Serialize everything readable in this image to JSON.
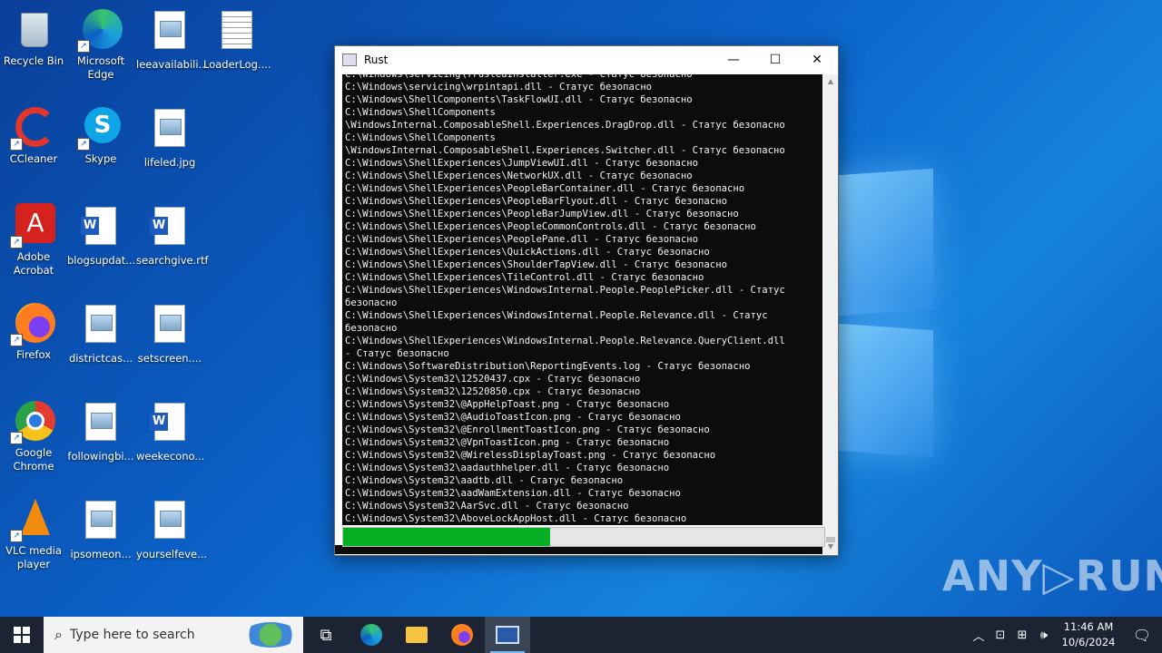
{
  "desktop": {
    "icons": [
      {
        "label": "Recycle Bin"
      },
      {
        "label": "Microsoft\nEdge"
      },
      {
        "label": "leeavailabili..."
      },
      {
        "label": "LoaderLog...."
      },
      {
        "label": "CCleaner"
      },
      {
        "label": "Skype"
      },
      {
        "label": "lifeled.jpg"
      },
      {
        "label": "Adobe\nAcrobat"
      },
      {
        "label": "blogsupdat..."
      },
      {
        "label": "searchgive.rtf"
      },
      {
        "label": "Firefox"
      },
      {
        "label": "districtcas..."
      },
      {
        "label": "setscreen...."
      },
      {
        "label": "Google\nChrome"
      },
      {
        "label": "followingbi..."
      },
      {
        "label": "weekecono..."
      },
      {
        "label": "VLC media\nplayer"
      },
      {
        "label": "ipsomeon..."
      },
      {
        "label": "yourselfeve..."
      }
    ]
  },
  "window": {
    "title": "Rust",
    "controls": {
      "minimize": "—",
      "maximize": "☐",
      "close": "✕"
    },
    "console_lines": [
      "C:\\Windows\\servicing\\TrustedInstaller.exe - Статус безопасно",
      "C:\\Windows\\servicing\\wrpintapi.dll - Статус безопасно",
      "C:\\Windows\\ShellComponents\\TaskFlowUI.dll - Статус безопасно",
      "C:\\Windows\\ShellComponents",
      "\\WindowsInternal.ComposableShell.Experiences.DragDrop.dll - Статус безопасно",
      "C:\\Windows\\ShellComponents",
      "\\WindowsInternal.ComposableShell.Experiences.Switcher.dll - Статус безопасно",
      "C:\\Windows\\ShellExperiences\\JumpViewUI.dll - Статус безопасно",
      "C:\\Windows\\ShellExperiences\\NetworkUX.dll - Статус безопасно",
      "C:\\Windows\\ShellExperiences\\PeopleBarContainer.dll - Статус безопасно",
      "C:\\Windows\\ShellExperiences\\PeopleBarFlyout.dll - Статус безопасно",
      "C:\\Windows\\ShellExperiences\\PeopleBarJumpView.dll - Статус безопасно",
      "C:\\Windows\\ShellExperiences\\PeopleCommonControls.dll - Статус безопасно",
      "C:\\Windows\\ShellExperiences\\PeoplePane.dll - Статус безопасно",
      "C:\\Windows\\ShellExperiences\\QuickActions.dll - Статус безопасно",
      "C:\\Windows\\ShellExperiences\\ShoulderTapView.dll - Статус безопасно",
      "C:\\Windows\\ShellExperiences\\TileControl.dll - Статус безопасно",
      "C:\\Windows\\ShellExperiences\\WindowsInternal.People.PeoplePicker.dll - Статус",
      "безопасно",
      "C:\\Windows\\ShellExperiences\\WindowsInternal.People.Relevance.dll - Статус",
      "безопасно",
      "C:\\Windows\\ShellExperiences\\WindowsInternal.People.Relevance.QueryClient.dll",
      "- Статус безопасно",
      "C:\\Windows\\SoftwareDistribution\\ReportingEvents.log - Статус безопасно",
      "C:\\Windows\\System32\\12520437.cpx - Статус безопасно",
      "C:\\Windows\\System32\\12520850.cpx - Статус безопасно",
      "C:\\Windows\\System32\\@AppHelpToast.png - Статус безопасно",
      "C:\\Windows\\System32\\@AudioToastIcon.png - Статус безопасно",
      "C:\\Windows\\System32\\@EnrollmentToastIcon.png - Статус безопасно",
      "C:\\Windows\\System32\\@VpnToastIcon.png - Статус безопасно",
      "C:\\Windows\\System32\\@WirelessDisplayToast.png - Статус безопасно",
      "C:\\Windows\\System32\\aadauthhelper.dll - Статус безопасно",
      "C:\\Windows\\System32\\aadtb.dll - Статус безопасно",
      "C:\\Windows\\System32\\aadWamExtension.dll - Статус безопасно",
      "C:\\Windows\\System32\\AarSvc.dll - Статус безопасно",
      "C:\\Windows\\System32\\AboveLockAppHost.dll - Статус безопасно"
    ],
    "progress_fraction": 0.43
  },
  "taskbar": {
    "search_placeholder": "Type here to search",
    "clock_time": "11:46 AM",
    "clock_date": "10/6/2024"
  },
  "watermark": "ANY▷RUN"
}
